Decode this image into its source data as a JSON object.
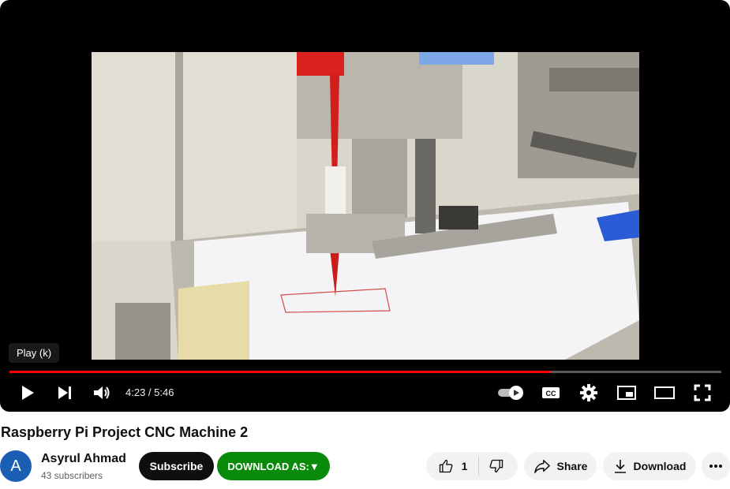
{
  "player": {
    "tooltip": "Play (k)",
    "time": "4:23 / 5:46",
    "progress": 0.759
  },
  "video": {
    "title": "Raspberry Pi Project CNC Machine 2"
  },
  "channel": {
    "avatar_letter": "A",
    "name": "Asyrul Ahmad",
    "subscribers": "43 subscribers"
  },
  "actions": {
    "subscribe": "Subscribe",
    "download_as": "DOWNLOAD AS:▼",
    "like_count": "1",
    "share": "Share",
    "download": "Download"
  },
  "colors": {
    "progress": "#ff0000",
    "subscribe_bg": "#0f0f0f",
    "download_as_bg": "#0a8a0a"
  },
  "icons": [
    "play-icon",
    "next-icon",
    "volume-icon",
    "autoplay-toggle",
    "captions-icon",
    "settings-icon",
    "miniplayer-icon",
    "theater-icon",
    "fullscreen-icon",
    "thumbs-up-icon",
    "thumbs-down-icon",
    "share-icon",
    "download-icon",
    "more-icon"
  ]
}
